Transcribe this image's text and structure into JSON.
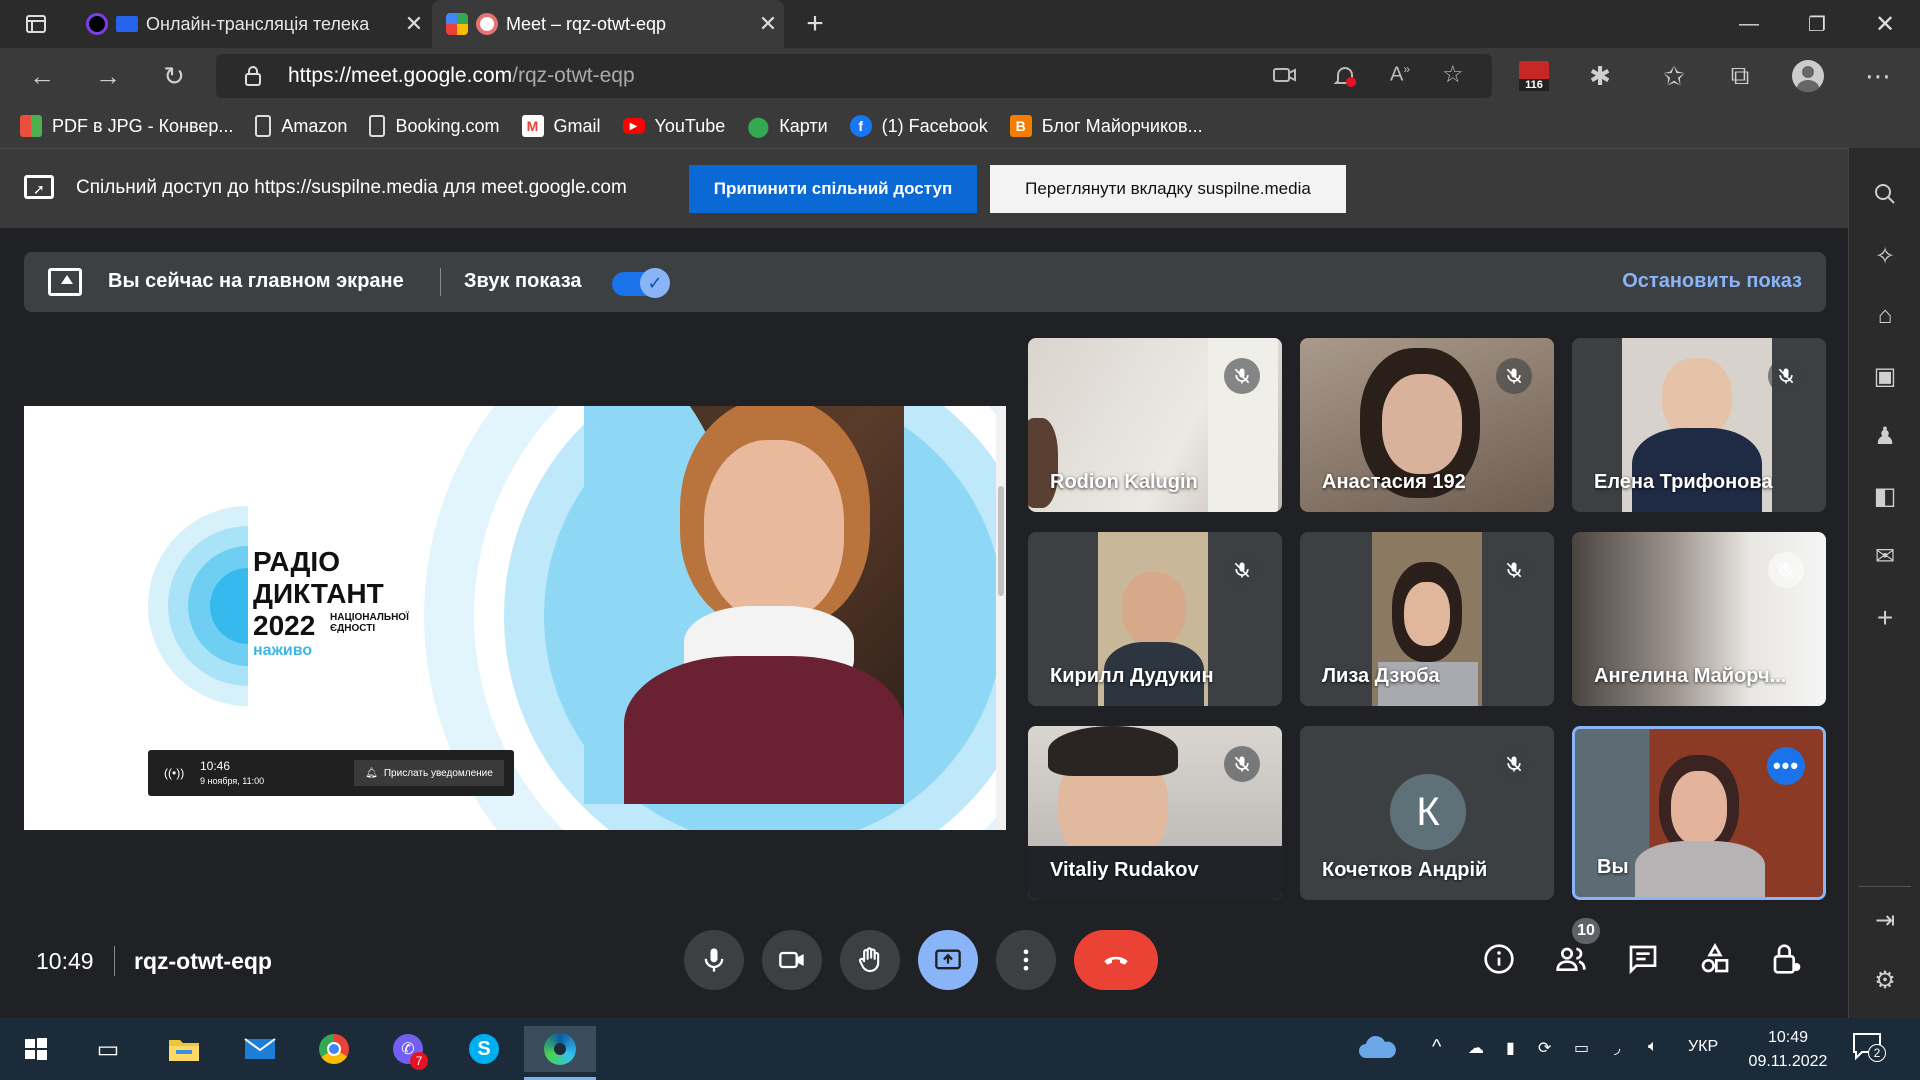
{
  "browser": {
    "tabs": [
      {
        "title": "Онлайн-трансляція телека",
        "active": false
      },
      {
        "title": "Meet – rqz-otwt-eqp",
        "active": true
      }
    ],
    "new_tab_symbol": "+",
    "url_host": "https://meet.google.com",
    "url_path": "/rqz-otwt-eqp",
    "ext_badge": "116",
    "bookmarks": [
      {
        "label": "PDF в JPG - Конвер...",
        "icon": "pdf-jpg-icon",
        "color": "#e94f3c"
      },
      {
        "label": "Amazon",
        "icon": "page-icon",
        "color": "#3a3a3a"
      },
      {
        "label": "Booking.com",
        "icon": "page-icon",
        "color": "#3a3a3a"
      },
      {
        "label": "Gmail",
        "icon": "gmail-icon",
        "color": "#ea4335"
      },
      {
        "label": "YouTube",
        "icon": "youtube-icon",
        "color": "#ff0000"
      },
      {
        "label": "Карти",
        "icon": "maps-icon",
        "color": "#34a853"
      },
      {
        "label": "(1) Facebook",
        "icon": "facebook-icon",
        "color": "#1877f2"
      },
      {
        "label": "Блог Майорчиков...",
        "icon": "blogger-icon",
        "color": "#f57d00"
      }
    ],
    "share_notice": "Спільний доступ до https://suspilne.media для meet.google.com",
    "stop_share_label": "Припинити спільний доступ",
    "view_tab_label": "Переглянути вкладку suspilne.media"
  },
  "meet": {
    "banner_text": "Вы сейчас на главном экране",
    "audio_label": "Звук показа",
    "audio_on": true,
    "stop_presenting": "Остановить показ",
    "shared_screen": {
      "title_line1": "РАДІО",
      "title_line2": "ДИКТАНТ",
      "year": "2022",
      "sub_line1": "НАЦІОНАЛЬНОЇ",
      "sub_line2": "ЄДНОСТІ",
      "live": "наживо",
      "time": "10:46",
      "date": "9 ноября, 11:00",
      "notify": "Прислать уведомление"
    },
    "participants": [
      {
        "name": "Rodion Kalugin",
        "muted": true
      },
      {
        "name": "Анастасия 192",
        "muted": true
      },
      {
        "name": "Елена Трифонова",
        "muted": true
      },
      {
        "name": "Кирилл Дудукин",
        "muted": true
      },
      {
        "name": "Лиза Дзюба",
        "muted": true
      },
      {
        "name": "Ангелина Майорч...",
        "muted": true
      },
      {
        "name": "Vitaliy Rudakov",
        "muted": true
      },
      {
        "name": "Кочетков Андрій",
        "muted": true,
        "avatar_letter": "К"
      },
      {
        "name": "Вы",
        "muted": false,
        "self": true
      }
    ],
    "clock": "10:49",
    "meeting_code": "rqz-otwt-eqp",
    "participant_count": "10",
    "colors": {
      "accent": "#8ab4f8",
      "end_call": "#ea4335",
      "primary": "#1a73e8"
    }
  },
  "taskbar": {
    "language": "УКР",
    "time": "10:49",
    "date": "09.11.2022",
    "viber_badge": "7",
    "notification_count": "2"
  }
}
